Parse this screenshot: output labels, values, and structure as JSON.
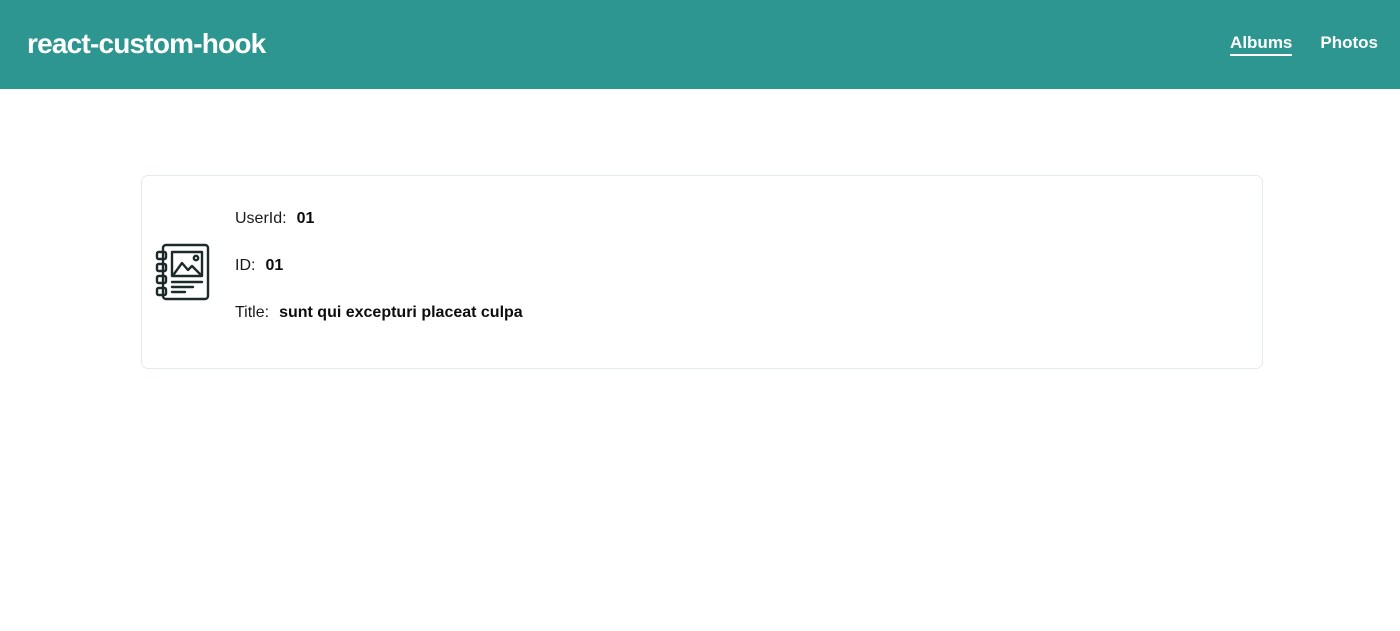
{
  "header": {
    "brand": "react-custom-hook",
    "background_color": "#2d9690",
    "nav": [
      {
        "label": "Albums",
        "active": true
      },
      {
        "label": "Photos",
        "active": false
      }
    ]
  },
  "card": {
    "icon": "photo-album-icon",
    "fields": {
      "user_id": {
        "label": "UserId:",
        "value": "01"
      },
      "id": {
        "label": "ID:",
        "value": "01"
      },
      "title": {
        "label": "Title:",
        "value": "sunt qui excepturi placeat culpa"
      }
    }
  }
}
